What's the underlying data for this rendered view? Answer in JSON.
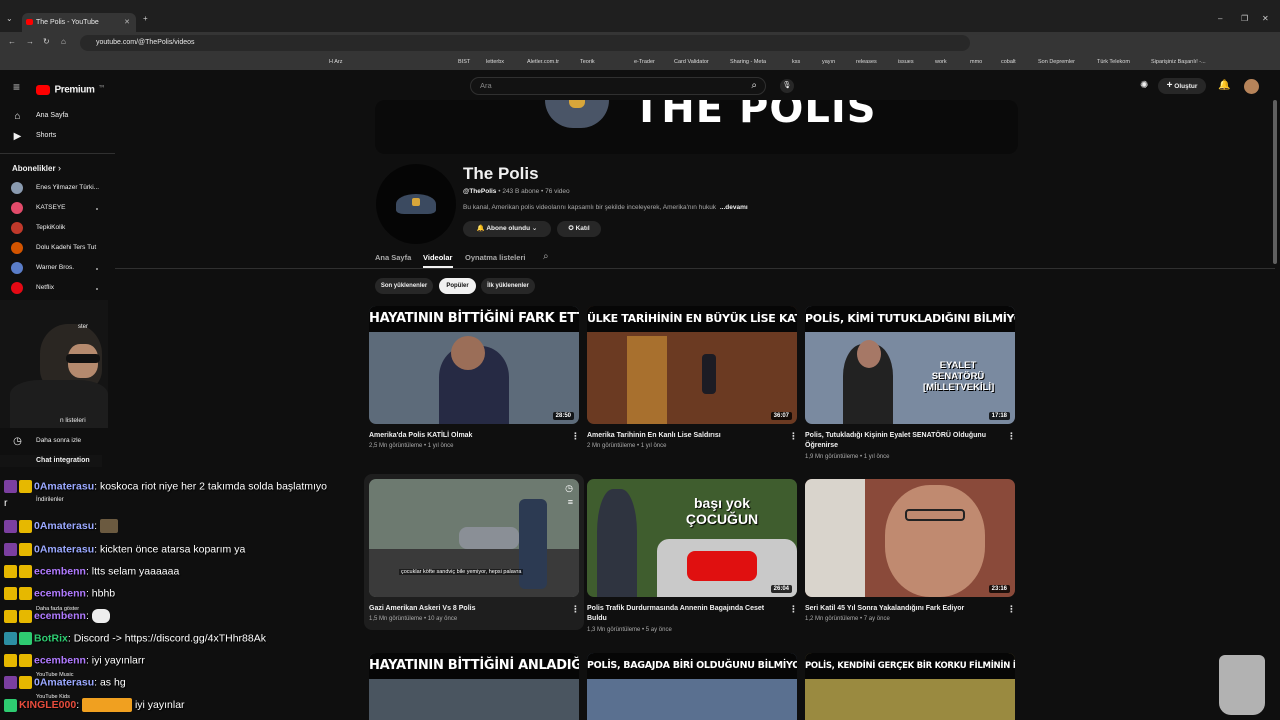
{
  "browser": {
    "tab_title": "The Polis - YouTube",
    "url": "youtube.com/@ThePolis/videos",
    "bookmarks": [
      "H Arz",
      "BIST",
      "letterbx",
      "Aletler.com.tr",
      "Teorik",
      "e-Trader",
      "Card Validator",
      "Sharing - Meta",
      "kss",
      "yayın",
      "releases",
      "issues",
      "work",
      "mmo",
      "cobalt",
      "Son Depremler",
      "Türk Telekom",
      "Siparişiniz Başarılı! -..."
    ]
  },
  "header": {
    "logo_text": "Premium",
    "logo_sup": "TR",
    "search_placeholder": "Ara",
    "create_label": "Oluştur"
  },
  "sidebar": {
    "items": [
      {
        "label": "Ana Sayfa",
        "icon": "home-icon"
      },
      {
        "label": "Shorts",
        "icon": "shorts-icon"
      }
    ],
    "subs_header": "Abonelikler",
    "subs_chevron": "›",
    "subs": [
      {
        "label": "Enes Yilmazer Türki...",
        "color": "#8a9bb0"
      },
      {
        "label": "KATSEYE",
        "color": "#e24b6a"
      },
      {
        "label": "TepkiKolik",
        "color": "#c0392b"
      },
      {
        "label": "Dolu Kadehi Ters Tut",
        "color": "#d35400"
      },
      {
        "label": "Warner Bros.",
        "color": "#5a7dc8"
      },
      {
        "label": "Netflix",
        "color": "#e50914"
      }
    ],
    "bottom_partial": [
      "ster",
      "n listeleri"
    ],
    "watch_later": "Daha sonra izle",
    "downloads": "İndirilenler",
    "more_partial": [
      "Daha fazla göster",
      "YouTube Music",
      "YouTube Kids"
    ]
  },
  "channel": {
    "banner_text": "THE POLIS",
    "name": "The Polis",
    "handle": "@ThePolis",
    "stats": " • 243 B abone • 76 video",
    "description": "Bu kanal, Amerikan polis videolarını kapsamlı bir şekilde inceleyerek, Amerika'nın hukuk",
    "more": "...devamı",
    "subscribed_label": "Abone olundu",
    "join_label": "Katıl",
    "tabs": [
      "Ana Sayfa",
      "Videolar",
      "Oynatma listeleri"
    ],
    "filters": [
      "Son yüklenenler",
      "Popüler",
      "İlk yüklenenler"
    ]
  },
  "videos": [
    {
      "thumb_title": "HAYATININ BİTTİĞİNİ FARK ETTİĞİ AN!",
      "duration": "28:50",
      "title": "Amerika'da Polis KATİLİ Olmak",
      "meta": "2,5 Mn görüntüleme • 1 yıl önce",
      "bg": "#5d6b7a"
    },
    {
      "thumb_title": "ÜLKE TARİHİNİN EN BÜYÜK LİSE KATLİAMI",
      "duration": "36:07",
      "title": "Amerika Tarihinin En Kanlı Lise Saldırısı",
      "meta": "2 Mn görüntüleme • 1 yıl önce",
      "bg": "#6b3a22"
    },
    {
      "thumb_title": "POLİS, KİMİ TUTUKLADIĞINI BİLMİYORDU!",
      "duration": "17:18",
      "title": "Polis, Tutukladığı Kişinin Eyalet SENATÖRÜ Olduğunu Öğrenirse",
      "meta": "1,9 Mn görüntüleme • 1 yıl önce",
      "bg": "#7a8aa0",
      "overlay": "EYALET SENATÖRÜ [MİLLETVEKİLİ]"
    },
    {
      "thumb_title": "",
      "duration": "",
      "title": "Gazi Amerikan Askeri Vs 8 Polis",
      "meta": "1,5 Mn görüntüleme • 10 ay önce",
      "bg": "#6d7a70",
      "caption": "çocuklar köfte sandviç bile yemiyor, hepsi palavra"
    },
    {
      "thumb_title": "",
      "duration": "26:04",
      "title": "Polis Trafik Durdurmasında Annenin Bagajında Ceset Buldu",
      "meta": "1,3 Mn görüntüleme • 5 ay önce",
      "bg": "#3f5d2e",
      "overlay": "başı yok ÇOCUĞUN"
    },
    {
      "thumb_title": "",
      "duration": "23:16",
      "title": "Seri Katil 45 Yıl Sonra Yakalandığını Fark Ediyor",
      "meta": "1,2 Mn görüntüleme • 7 ay önce",
      "bg": "#8a4a3a"
    },
    {
      "thumb_title": "HAYATININ BİTTİĞİNİ ANLADIĞI AN!",
      "duration": "",
      "title": "",
      "meta": "",
      "bg": "#4a5560"
    },
    {
      "thumb_title": "POLİS, BAGAJDA BİRİ OLDUĞUNU BİLMİYORDU",
      "duration": "",
      "title": "",
      "meta": "",
      "bg": "#5a7090"
    },
    {
      "thumb_title": "POLİS, KENDİNİ GERÇEK BİR KORKU FİLMİNİN İÇİNDE BULDU.",
      "duration": "",
      "title": "",
      "meta": "",
      "bg": "#9a8a40"
    }
  ],
  "chat": {
    "integration_label": "Chat integration",
    "messages": [
      {
        "user": "0Amaterasu",
        "text": "koskoca riot niye her 2 takımda solda başlatmıyo",
        "color": "#9aa8ff"
      },
      {
        "user": "0Amaterasu",
        "text": "",
        "color": "#9aa8ff"
      },
      {
        "user": "0Amaterasu",
        "text": "kickten önce atarsa koparım ya",
        "color": "#9aa8ff"
      },
      {
        "user": "ecembenn",
        "text": "ltts selam yaaaaaa",
        "color": "#b07aff"
      },
      {
        "user": "ecembenn",
        "text": "hbhb",
        "color": "#b07aff"
      },
      {
        "user": "ecembenn",
        "text": "",
        "color": "#b07aff"
      },
      {
        "user": "BotRix",
        "text": "Discord -> https://discord.gg/4xTHhr88Ak",
        "color": "#2ecc71"
      },
      {
        "user": "ecembenn",
        "text": "iyi yayınlarr",
        "color": "#b07aff"
      },
      {
        "user": "0Amaterasu",
        "text": "as hg",
        "color": "#9aa8ff"
      },
      {
        "user": "KINGLE000",
        "text": "iyi yayınlar",
        "color": "#e74c3c"
      }
    ],
    "partial_first": "r"
  }
}
